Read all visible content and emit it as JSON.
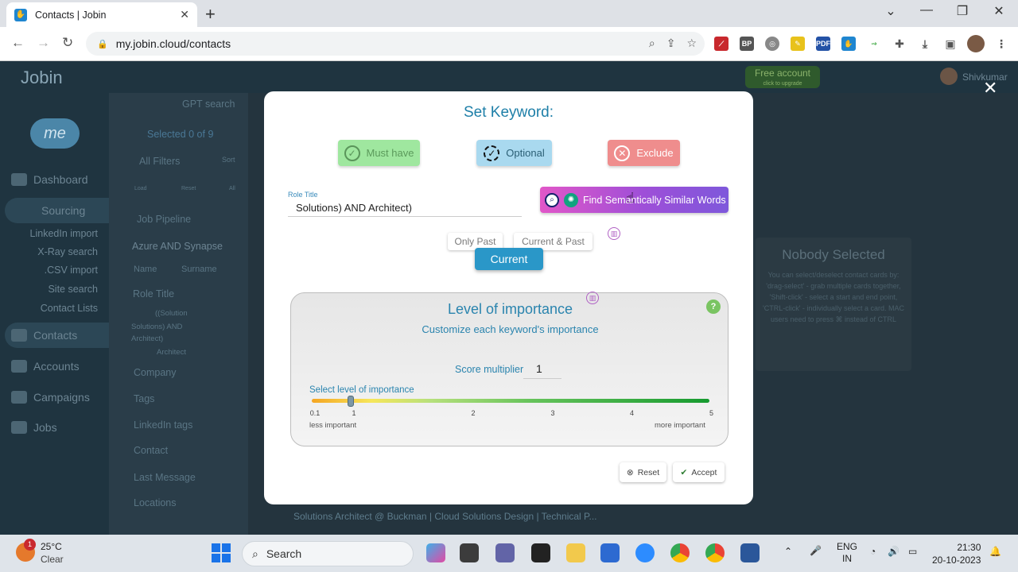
{
  "browser": {
    "tab_title": "Contacts | Jobin",
    "url": "my.jobin.cloud/contacts"
  },
  "app": {
    "logo": "Jobin",
    "nav": {
      "dashboard": "Dashboard",
      "sourcing": "Sourcing",
      "linkedin_import": "LinkedIn import",
      "xray": "X-Ray search",
      "csv": ".CSV import",
      "site_search": "Site search",
      "contact_lists": "Contact Lists",
      "contacts": "Contacts",
      "accounts": "Accounts",
      "campaigns": "Campaigns",
      "jobs": "Jobs"
    },
    "header": {
      "free_account": "Free account",
      "free_account_sub": "click to upgrade",
      "user": "Shivkumar"
    },
    "filters": {
      "gpt_search": "GPT search",
      "selected": "Selected 0 of 9",
      "all_filters": "All Filters",
      "sort": "Sort",
      "load": "Load",
      "reset": "Reset",
      "all": "All",
      "job_pipeline": "Job Pipeline",
      "query": "Azure AND Synapse",
      "name": "Name",
      "surname": "Surname",
      "role_title": "Role Title",
      "role_chip_1": "((Solution",
      "role_chip_2": "Solutions) AND",
      "role_chip_3": "Architect)",
      "role_chip_4": "Architect",
      "company": "Company",
      "tags": "Tags",
      "linkedin_tags": "LinkedIn tags",
      "contact": "Contact",
      "last_message": "Last Message",
      "locations": "Locations"
    },
    "nobody": {
      "title": "Nobody Selected",
      "hint": "You can select/deselect contact cards by: 'drag-select' - grab multiple cards together, 'Shift-click' - select a start and end point, 'CTRL-click' - individually select a card. MAC users need to press ⌘ instead of CTRL"
    },
    "result_line": "Solutions Architect @ Buckman | Cloud Solutions Design | Technical P..."
  },
  "modal": {
    "title": "Set Keyword:",
    "must_have": "Must have",
    "optional": "Optional",
    "exclude": "Exclude",
    "field_label": "Role Title",
    "field_value": "Solutions) AND Architect)",
    "semantic_button": "Find Semantically Similar Words",
    "only_past": "Only Past",
    "current_past": "Current & Past",
    "current": "Current",
    "importance": {
      "title": "Level of importance",
      "subtitle": "Customize each keyword's importance",
      "score_label": "Score multiplier",
      "score_value": "1",
      "slider_label": "Select level of importance",
      "slider_value": 1,
      "slider_min": 0.1,
      "slider_max": 5,
      "ticks": [
        "0.1",
        "1",
        "2",
        "3",
        "4",
        "5"
      ],
      "less": "less important",
      "more": "more important"
    },
    "reset": "Reset",
    "accept": "Accept"
  },
  "taskbar": {
    "temp": "25°C",
    "weather": "Clear",
    "weather_badge": "1",
    "search": "Search",
    "lang_1": "ENG",
    "lang_2": "IN",
    "time": "21:30",
    "date": "20-10-2023"
  },
  "colors": {
    "accent": "#2a97c8",
    "must_have": "#9fe79f",
    "optional": "#a9d9ef",
    "exclude": "#ef8d8d"
  }
}
